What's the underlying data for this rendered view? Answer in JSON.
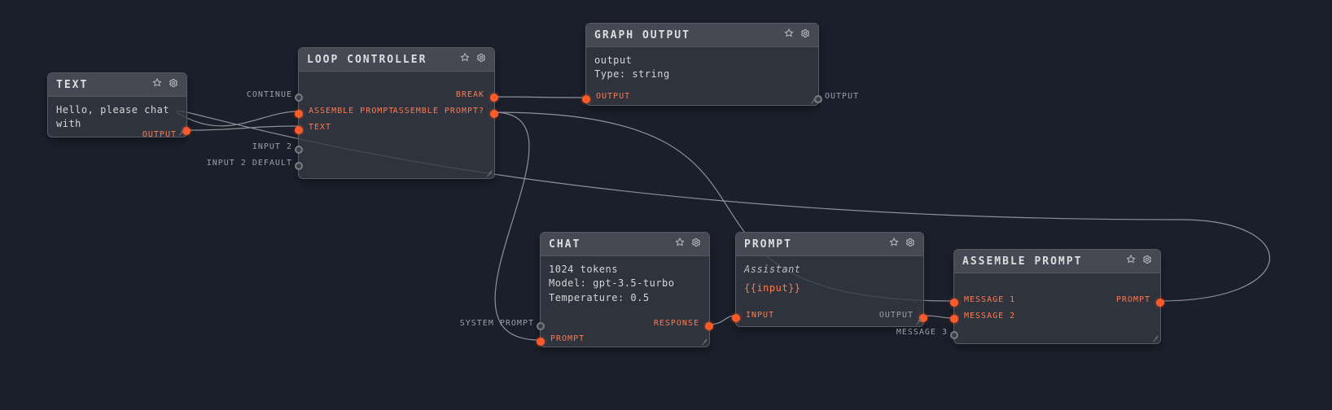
{
  "nodes": {
    "text": {
      "title": "TEXT",
      "body_text": "Hello, please chat with",
      "outputs": {
        "output": "OUTPUT"
      }
    },
    "loop": {
      "title": "LOOP CONTROLLER",
      "inputs": {
        "continue": "CONTINUE",
        "assemble_prompt": "ASSEMBLE PROMPT",
        "text": "TEXT",
        "input2": "INPUT 2",
        "input2_default": "INPUT 2 DEFAULT"
      },
      "outputs": {
        "break": "BREAK",
        "assemble_prompt_q": "ASSEMBLE PROMPT?"
      }
    },
    "graph_output": {
      "title": "GRAPH OUTPUT",
      "body_line1": "output",
      "body_line2": "Type: string",
      "inputs": {
        "output": "OUTPUT"
      },
      "outputs": {
        "output": "OUTPUT"
      }
    },
    "chat": {
      "title": "CHAT",
      "body_line1": "1024 tokens",
      "body_line2": "Model: gpt-3.5-turbo",
      "body_line3": "Temperature: 0.5",
      "inputs": {
        "system_prompt": "SYSTEM PROMPT",
        "prompt": "PROMPT"
      },
      "outputs": {
        "response": "RESPONSE"
      }
    },
    "prompt": {
      "title": "PROMPT",
      "body_line1": "Assistant",
      "body_line2": "{{input}}",
      "inputs": {
        "input": "INPUT"
      },
      "outputs": {
        "output": "OUTPUT"
      }
    },
    "assemble": {
      "title": "ASSEMBLE PROMPT",
      "inputs": {
        "m1": "MESSAGE 1",
        "m2": "MESSAGE 2",
        "m3": "MESSAGE 3"
      },
      "outputs": {
        "prompt": "PROMPT"
      }
    }
  }
}
